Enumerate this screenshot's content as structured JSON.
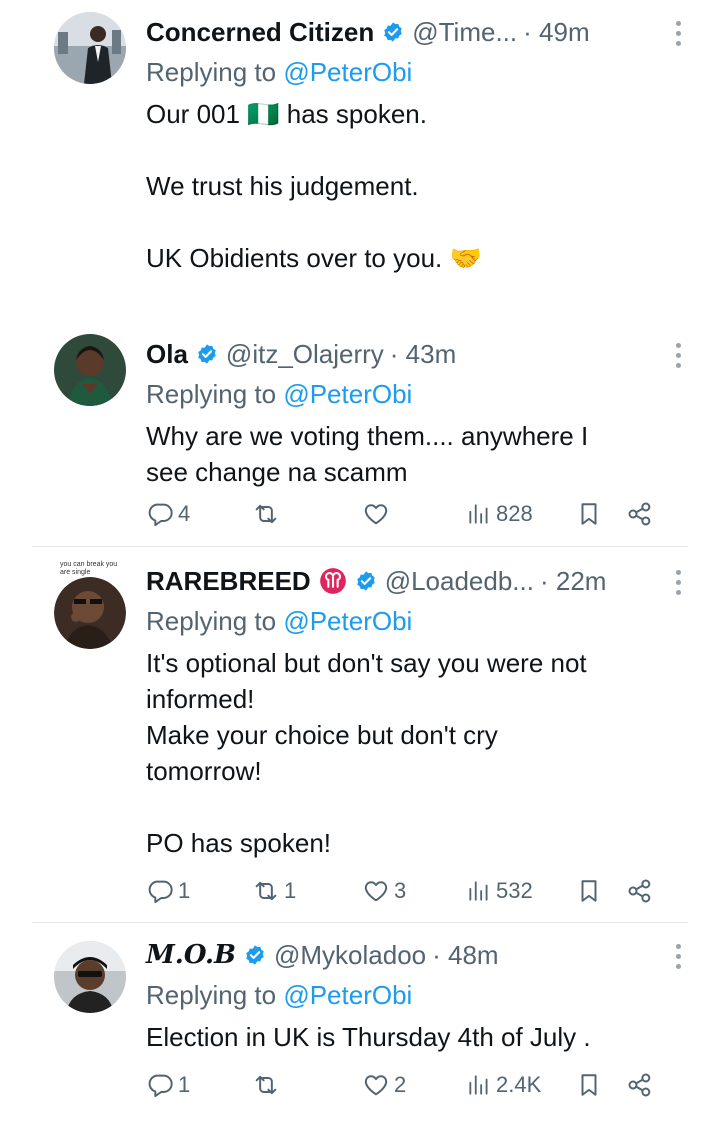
{
  "tweets": [
    {
      "name": "Concerned Citizen",
      "handle": "@Time...",
      "time": "· 49m",
      "replying_label": "Replying to",
      "replying_to": "@PeterObi",
      "lines": [
        "Our 001 🇳🇬 has spoken.",
        "",
        "We trust his judgement.",
        "",
        "UK Obidients over to you. 🤝"
      ],
      "actions": null
    },
    {
      "name": "Ola",
      "handle": "@itz_Olajerry",
      "time": "· 43m",
      "replying_label": "Replying to",
      "replying_to": "@PeterObi",
      "lines": [
        "Why are we voting them.... anywhere I",
        "see change na scamm"
      ],
      "actions": {
        "replies": "4",
        "reposts": "",
        "likes": "",
        "views": "828"
      }
    },
    {
      "name": "RAREBREED",
      "name_emoji": "♈",
      "avatar_caption": "you can break you are single",
      "handle": "@Loadedb...",
      "time": "· 22m",
      "replying_label": "Replying to",
      "replying_to": "@PeterObi",
      "lines": [
        "It's optional but don't say you were not",
        "informed!",
        "Make your choice but don't cry",
        "tomorrow!",
        "",
        "PO has spoken!"
      ],
      "actions": {
        "replies": "1",
        "reposts": "1",
        "likes": "3",
        "views": "532"
      }
    },
    {
      "name": "M.O.B",
      "handle": "@Mykoladoo",
      "time": "· 48m",
      "replying_label": "Replying to",
      "replying_to": "@PeterObi",
      "lines": [
        "Election in UK is Thursday 4th of July ."
      ],
      "actions": {
        "replies": "1",
        "reposts": "",
        "likes": "2",
        "views": "2.4K"
      }
    }
  ],
  "icons": {
    "verified": "verified-badge-icon",
    "reply": "reply-icon",
    "repost": "repost-icon",
    "like": "heart-icon",
    "views": "views-icon",
    "bookmark": "bookmark-icon",
    "share": "share-icon",
    "more": "more-icon"
  },
  "colors": {
    "link": "#1d9bf0",
    "secondary_text": "#536471",
    "verified": "#1d9bf0",
    "divider": "#e3e6e9"
  }
}
